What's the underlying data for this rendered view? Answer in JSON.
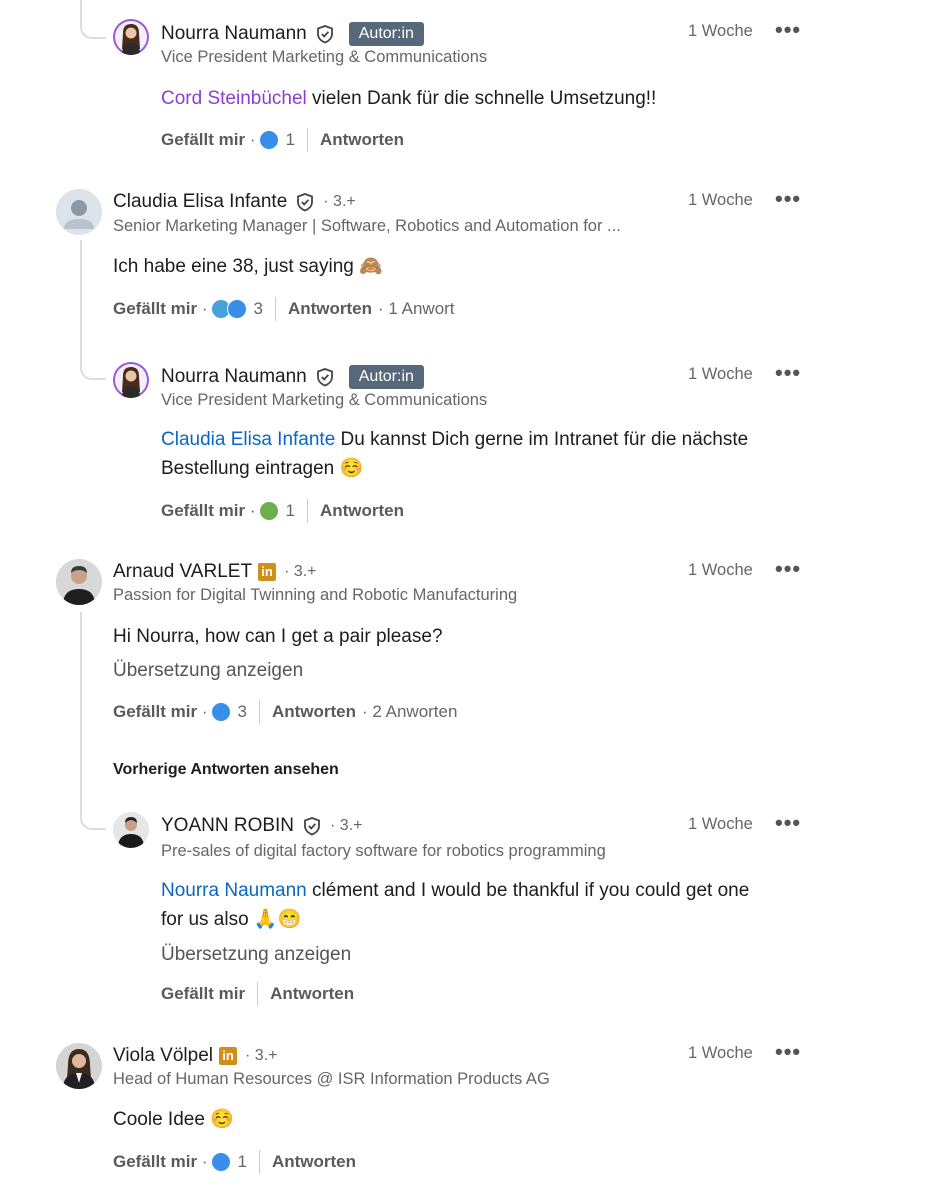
{
  "comments": [
    {
      "name": "Nourra Naumann",
      "badge": "Autor:in",
      "headline": "Vice President Marketing & Communications",
      "time": "1 Woche",
      "mention": "Cord Steinbüchel",
      "text": " vielen Dank für die schnelle Umsetzung!!",
      "like": "Gefällt mir",
      "count": "1",
      "reply": "Antworten"
    },
    {
      "name": "Claudia Elisa Infante",
      "degree": "· 3.+",
      "headline": "Senior Marketing Manager | Software, Robotics and Automation for ...",
      "time": "1 Woche",
      "text": "Ich habe eine 38, just saying 🙈",
      "like": "Gefällt mir",
      "count": "3",
      "reply": "Antworten",
      "replies": "· 1 Anwort"
    },
    {
      "name": "Nourra Naumann",
      "badge": "Autor:in",
      "headline": "Vice President Marketing & Communications",
      "time": "1 Woche",
      "mention": "Claudia Elisa Infante",
      "text_line1": " Du kannst Dich gerne im Intranet für die nächste",
      "text_line2": "Bestellung eintragen ☺️",
      "like": "Gefällt mir",
      "count": "1",
      "reply": "Antworten"
    },
    {
      "name": "Arnaud VARLET",
      "degree": "· 3.+",
      "headline": "Passion for Digital Twinning and Robotic Manufacturing",
      "time": "1 Woche",
      "text": "Hi Nourra, how can I get a pair please?",
      "translate": "Übersetzung anzeigen",
      "like": "Gefällt mir",
      "count": "3",
      "reply": "Antworten",
      "replies": "· 2 Anworten",
      "prev": "Vorherige Antworten ansehen"
    },
    {
      "name": "YOANN ROBIN",
      "degree": "· 3.+",
      "headline": "Pre-sales of digital factory software for robotics programming",
      "time": "1 Woche",
      "mention": "Nourra Naumann",
      "text_line1": " clément and I would be thankful if you could get one",
      "text_line2": "for us also 🙏😁",
      "translate": "Übersetzung anzeigen",
      "like": "Gefällt mir",
      "reply": "Antworten"
    },
    {
      "name": "Viola Völpel",
      "degree": "· 3.+",
      "headline": "Head of Human Resources @ ISR Information Products AG",
      "time": "1 Woche",
      "text": "Coole Idee ☺️",
      "like": "Gefällt mir",
      "count": "1",
      "reply": "Antworten"
    }
  ],
  "more_icon": "more-horizontal-icon",
  "verified_icon": "shield-check-icon",
  "linkedin_icon": "linkedin-in-icon",
  "colors": {
    "mention_blue": "#0a66c2",
    "mention_purple": "#8b3fd1",
    "author_badge": "#56687a",
    "premium_badge": "#d08e1b"
  }
}
